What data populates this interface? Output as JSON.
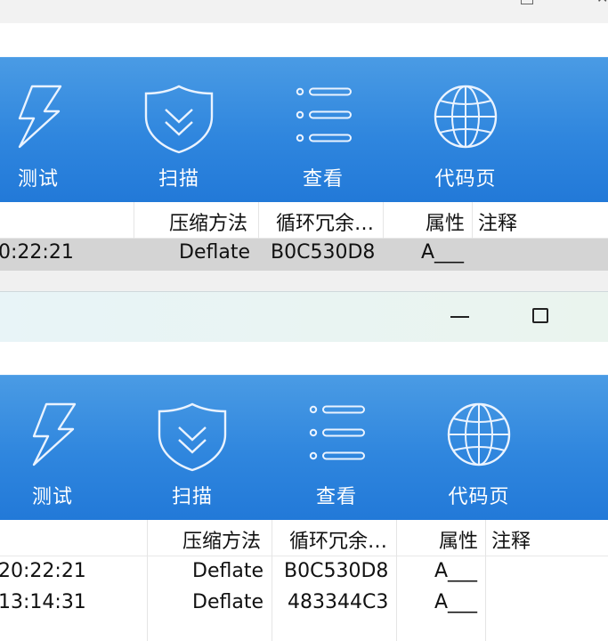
{
  "window_top": {
    "maximize_icon": "square-icon",
    "close_icon": "close-icon"
  },
  "toolbar": {
    "items": [
      {
        "label": "测试",
        "icon": "lightning-icon"
      },
      {
        "label": "扫描",
        "icon": "shield-icon"
      },
      {
        "label": "查看",
        "icon": "list-icon"
      },
      {
        "label": "代码页",
        "icon": "globe-icon"
      }
    ]
  },
  "columns": {
    "method": "压缩方法",
    "crc": "循环冗余…",
    "attr": "属性",
    "comment": "注释"
  },
  "window1_rows": [
    {
      "time": "0:22:21",
      "method": "Deflate",
      "crc": "B0C530D8",
      "attr": "A___"
    }
  ],
  "window2": {
    "minimize_icon": "minimize-icon",
    "maximize_icon": "maximize-icon"
  },
  "window2_rows": [
    {
      "time": "20:22:21",
      "method": "Deflate",
      "crc": "B0C530D8",
      "attr": "A___"
    },
    {
      "time": "13:14:31",
      "method": "Deflate",
      "crc": "483344C3",
      "attr": "A___"
    }
  ],
  "colors": {
    "toolbar_blue": "#2f86de",
    "selection_gray": "#d4d4d4",
    "titlebar_tint": "#e8f4f7"
  }
}
